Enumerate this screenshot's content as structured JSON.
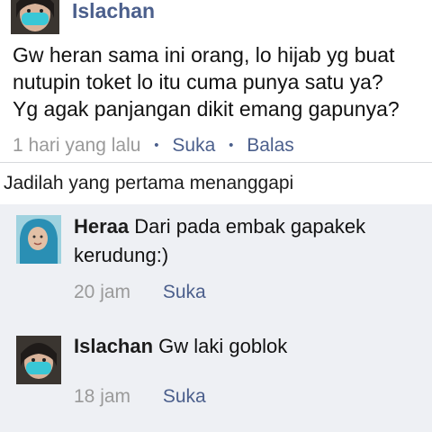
{
  "post": {
    "author": "Islachan",
    "lines": [
      "Gw heran sama ini orang, lo hijab yg buat",
      "nutupin toket lo itu cuma punya satu ya?",
      "Yg agak panjangan dikit emang gapunya?"
    ],
    "time": "1 hari yang lalu",
    "like_label": "Suka",
    "reply_label": "Balas",
    "separator": "•"
  },
  "first_reply_prompt": "Jadilah yang pertama menanggapi",
  "replies": [
    {
      "author": "Heraa",
      "text": "Dari pada embak gapakek kerudung:)",
      "time": "20 jam",
      "like_label": "Suka"
    },
    {
      "author": "Islachan",
      "text": "Gw laki goblok",
      "time": "18 jam",
      "like_label": "Suka"
    }
  ],
  "colors": {
    "link": "#4b5f8c",
    "meta": "#9a9a9a",
    "reply_background": "#eef0f4",
    "divider": "#d7d9dd"
  }
}
